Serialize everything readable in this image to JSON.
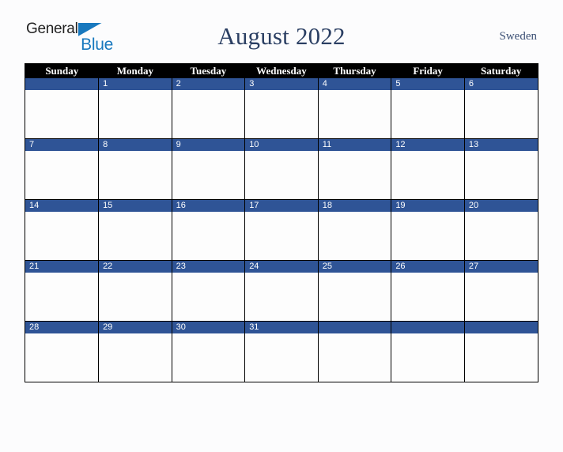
{
  "branding": {
    "logo_text_primary": "General",
    "logo_text_secondary": "Blue",
    "logo_flag_color": "#1878be"
  },
  "header": {
    "title": "August 2022",
    "region": "Sweden"
  },
  "theme": {
    "header_row_bg": "#000000",
    "date_bar_bg": "#2f5496",
    "date_text": "#ffffff",
    "title_color": "#2b3f63",
    "page_bg": "#fcfcfd",
    "cell_bg": "#fdfdfd",
    "border_color": "#000000"
  },
  "calendar": {
    "month": "August",
    "year": 2022,
    "weekday_headers": [
      "Sunday",
      "Monday",
      "Tuesday",
      "Wednesday",
      "Thursday",
      "Friday",
      "Saturday"
    ],
    "weeks": [
      {
        "days": [
          "",
          "1",
          "2",
          "3",
          "4",
          "5",
          "6"
        ]
      },
      {
        "days": [
          "7",
          "8",
          "9",
          "10",
          "11",
          "12",
          "13"
        ]
      },
      {
        "days": [
          "14",
          "15",
          "16",
          "17",
          "18",
          "19",
          "20"
        ]
      },
      {
        "days": [
          "21",
          "22",
          "23",
          "24",
          "25",
          "26",
          "27"
        ]
      },
      {
        "days": [
          "28",
          "29",
          "30",
          "31",
          "",
          "",
          ""
        ]
      }
    ]
  }
}
